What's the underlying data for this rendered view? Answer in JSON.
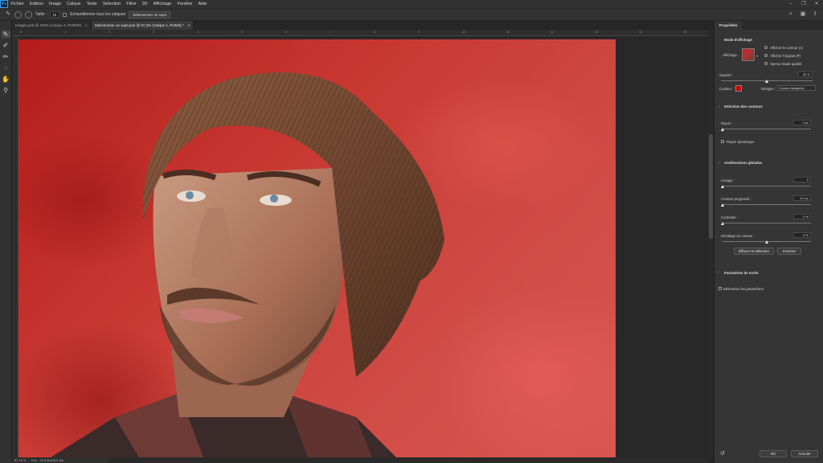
{
  "app": {
    "logo": "Ps"
  },
  "menu": [
    "Fichier",
    "Edition",
    "Image",
    "Calque",
    "Texte",
    "Sélection",
    "Filtre",
    "3D",
    "Affichage",
    "Fenêtre",
    "Aide"
  ],
  "options": {
    "size_label": "Taille :",
    "size_value": "10",
    "sample_all_label": "Echantillonner tous les calques",
    "select_subject_btn": "Sélectionner un sujet"
  },
  "tabs": [
    {
      "label": "Images.psd @ 100% (Calque 4, RVB/8#)",
      "close": "×"
    },
    {
      "label": "Sélectionner un sujet.psd @ 87,2% (Calque 1, RVB/8) *",
      "close": "×"
    }
  ],
  "ruler": {
    "ticks": [
      "0",
      "1",
      "2",
      "3",
      "4",
      "5",
      "6",
      "7",
      "8",
      "9",
      "10",
      "11",
      "12",
      "13",
      "14",
      "15"
    ]
  },
  "status": {
    "zoom": "87,16 %",
    "doc": "Doc : 16,8 Mo/28,8 Mo"
  },
  "panel": {
    "tab": "Propriétés",
    "view_mode_title": "Mode d'affichage",
    "view_label": "Affichage :",
    "radio_show_edge": "Afficher le contour (J)",
    "radio_show_original": "Afficher l'original (P)",
    "radio_hq_preview": "Aperçu haute qualité",
    "opacity_label": "Opacité :",
    "opacity_value": "50 %",
    "color_label": "Couleur :",
    "color_hex": "#d00000",
    "indicates_label": "Désigne :",
    "indicates_value": "Zones masquées",
    "edge_section": "Détection des contours",
    "radius_label": "Rayon :",
    "radius_value": "0 px",
    "smart_radius": "Rayon dynamique",
    "global_section": "Améliorations globales",
    "smooth_label": "Lissage :",
    "smooth_value": "0",
    "feather_label": "Contour progressif :",
    "feather_value": "0,0 px",
    "contrast_label": "Contraste :",
    "contrast_value": "0 %",
    "shift_label": "Décalage du contour :",
    "shift_value": "0 %",
    "clear_btn": "Effacer la sélection",
    "invert_btn": "Inverser",
    "output_section": "Paramètres de sortie",
    "remember_label": "Mémoriser les paramètres",
    "ok_btn": "OK",
    "cancel_btn": "Annuler"
  }
}
